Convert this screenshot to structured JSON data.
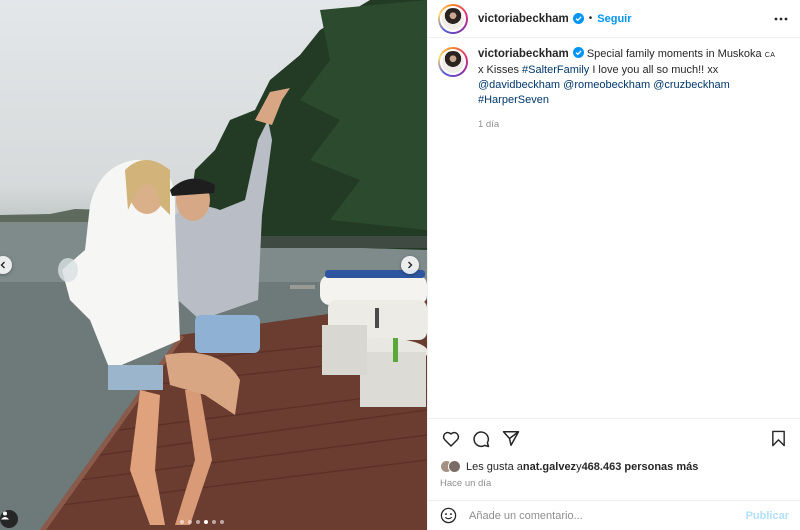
{
  "post": {
    "username": "victoriabeckham",
    "separator": "•",
    "follow_label": "Seguir",
    "caption": {
      "text_before": "Special family moments in Muskoka ",
      "flag": "CA",
      "text_middle": " x Kisses ",
      "tag_salter": "#SalterFamily",
      "text_after": " I love you all so much!! xx ",
      "mention_david": "@davidbeckham",
      "mention_romeo": "@romeobeckham",
      "mention_cruz": "@cruzbeckham",
      "tag_harper": "#HarperSeven",
      "time": "1 día"
    },
    "likes": {
      "prefix": "Les gusta a ",
      "user": "nat.galvez",
      "conjunction": " y ",
      "count_text": "468.463 personas más"
    },
    "posted_ago": "Hace un día",
    "comment": {
      "placeholder": "Añade un comentario...",
      "publish_label": "Publicar"
    },
    "carousel": {
      "total_slides": 6,
      "active_slide": 4
    }
  },
  "icons": {
    "verified": "verified-badge-icon",
    "more": "more-options-icon",
    "like": "heart-icon",
    "comment": "comment-bubble-icon",
    "share": "paper-plane-icon",
    "save": "bookmark-icon",
    "emoji": "smiley-icon",
    "prev": "chevron-left-icon",
    "next": "chevron-right-icon",
    "tags": "user-tag-icon"
  },
  "colors": {
    "accent": "#0095f6",
    "link": "#00376b",
    "muted": "#8e8e8e",
    "publish_disabled": "#b2dffc"
  }
}
